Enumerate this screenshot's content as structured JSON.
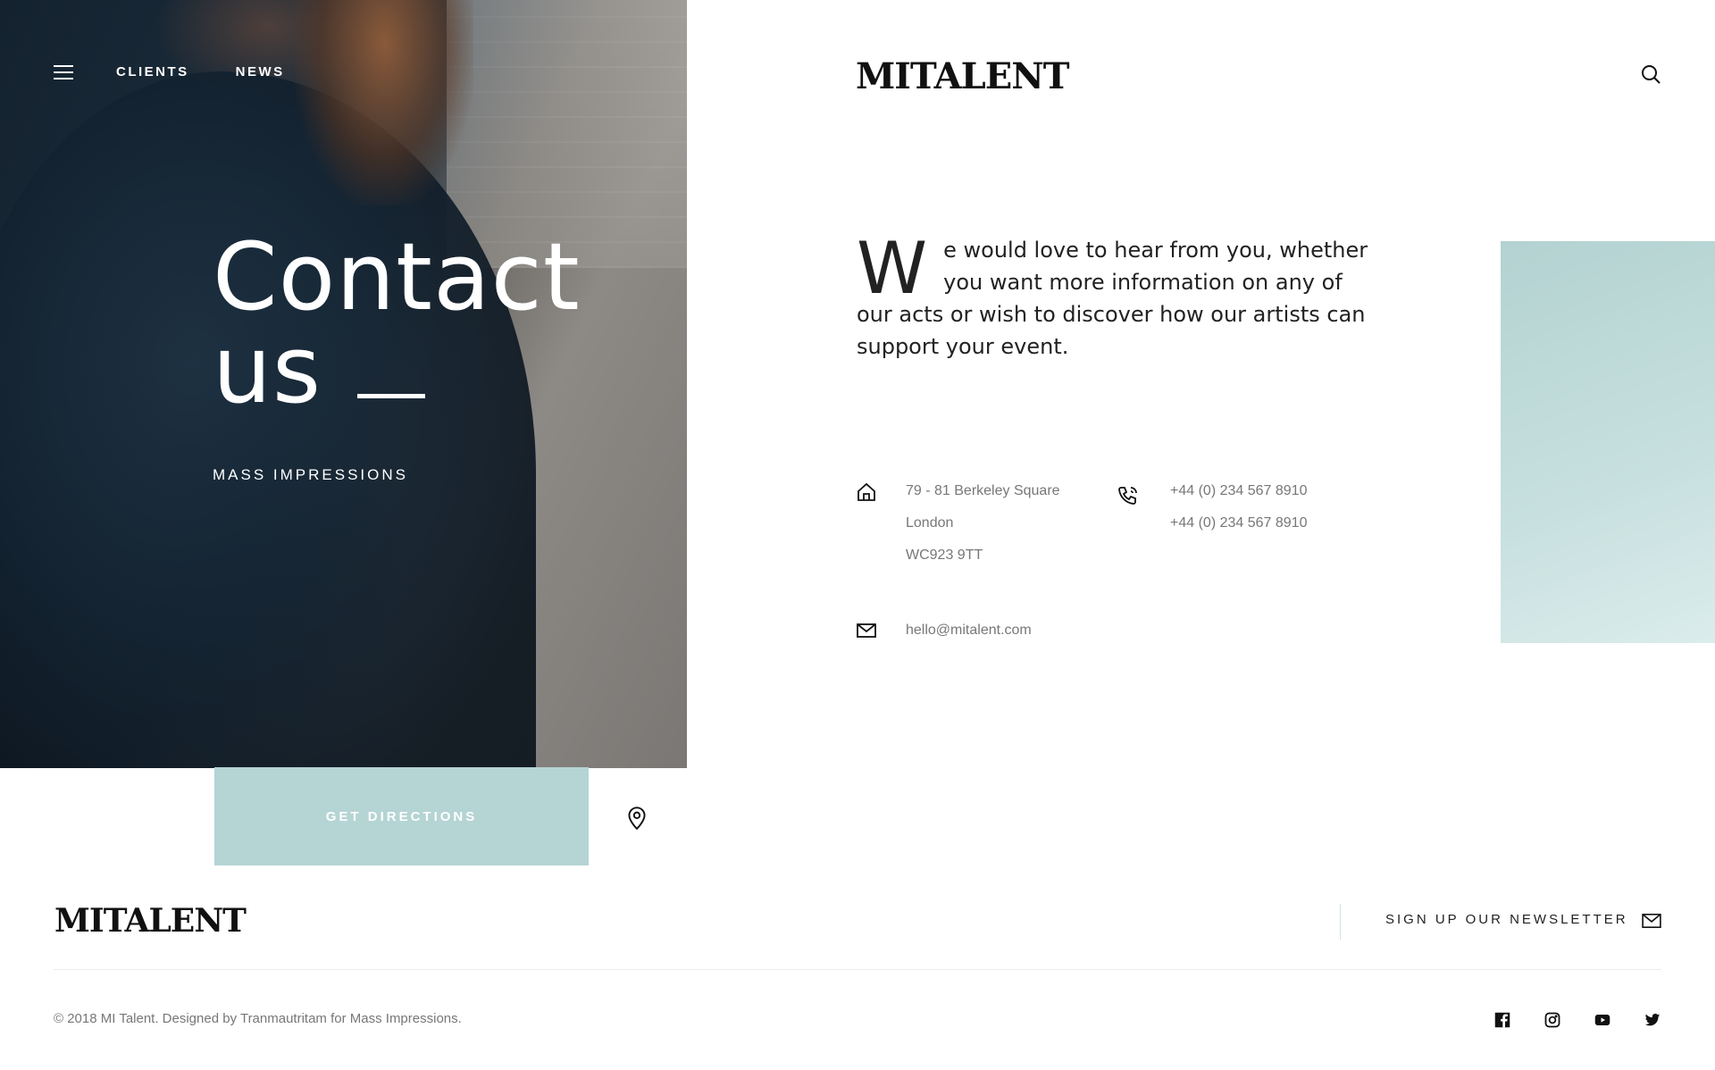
{
  "nav": {
    "items": [
      "CLIENTS",
      "NEWS"
    ]
  },
  "brand": {
    "logo": "MITALENT"
  },
  "hero": {
    "title_line1": "Contact",
    "title_line2": "us",
    "subtitle": "MASS IMPRESSIONS",
    "directions_label": "GET DIRECTIONS"
  },
  "intro": {
    "dropcap": "W",
    "text": "e would love to hear from you, whether you want more information on any of our acts or wish to discover how our artists can support your event."
  },
  "contact": {
    "address": [
      "79 - 81 Berkeley Square",
      "London",
      "WC923 9TT"
    ],
    "phones": [
      "+44 (0) 234 567 8910",
      "+44 (0) 234 567 8910"
    ],
    "email": "hello@mitalent.com"
  },
  "footer": {
    "logo": "MITALENT",
    "newsletter": "SIGN UP OUR NEWSLETTER",
    "copyright": "© 2018 MI Talent. Designed by Tranmautritam for Mass Impressions.",
    "social": [
      "facebook-icon",
      "instagram-icon",
      "youtube-icon",
      "twitter-icon"
    ]
  },
  "colors": {
    "accent": "#b5d4d4",
    "text": "#1b1b1b",
    "muted": "#777777"
  }
}
